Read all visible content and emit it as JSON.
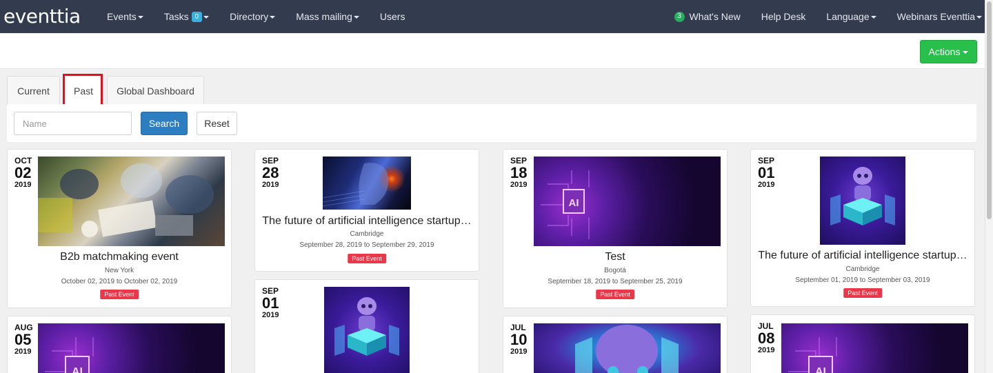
{
  "app": {
    "logo": "eventtia"
  },
  "nav": {
    "items": [
      {
        "label": "Events",
        "caret": true
      },
      {
        "label": "Tasks",
        "badge": "0",
        "caret": true
      },
      {
        "label": "Directory",
        "caret": true
      },
      {
        "label": "Mass mailing",
        "caret": true
      },
      {
        "label": "Users",
        "caret": false
      }
    ],
    "right": {
      "whats_new_count": "3",
      "whats_new": "What's New",
      "help_desk": "Help Desk",
      "language": "Language",
      "account": "Webinars Eventtia"
    }
  },
  "toolbar": {
    "actions_label": "Actions"
  },
  "tabs": [
    {
      "label": "Current",
      "active": false
    },
    {
      "label": "Past",
      "active": true
    },
    {
      "label": "Global Dashboard",
      "active": false
    }
  ],
  "search": {
    "placeholder": "Name",
    "search_label": "Search",
    "reset_label": "Reset"
  },
  "events": [
    {
      "month": "OCT",
      "day": "02",
      "year": "2019",
      "title": "B2b matchmaking event",
      "city": "New York",
      "dates": "October 02, 2019 to October 02, 2019",
      "status": "Past Event",
      "image": "meeting-photo"
    },
    {
      "month": "SEP",
      "day": "28",
      "year": "2019",
      "title": "The future of artificial intelligence startup…",
      "city": "Cambridge",
      "dates": "September 28, 2019 to September 29, 2019",
      "status": "Past Event",
      "image": "tech-face-image"
    },
    {
      "month": "SEP",
      "day": "18",
      "year": "2019",
      "title": "Test",
      "city": "Bogotá",
      "dates": "September 18, 2019 to September 25, 2019",
      "status": "Past Event",
      "image": "ai-chip-image"
    },
    {
      "month": "SEP",
      "day": "01",
      "year": "2019",
      "title": "The future of artificial intelligence startup…",
      "city": "Cambridge",
      "dates": "September 01, 2019 to September 03, 2019",
      "status": "Past Event",
      "image": "robot-image"
    },
    {
      "month": "AUG",
      "day": "05",
      "year": "2019",
      "image": "ai-chip-image"
    },
    {
      "month": "SEP",
      "day": "01",
      "year": "2019",
      "image": "robot-image"
    },
    {
      "month": "JUL",
      "day": "10",
      "year": "2019",
      "image": "robot-image"
    },
    {
      "month": "JUL",
      "day": "08",
      "year": "2019",
      "image": "ai-chip-image"
    }
  ],
  "chip_label": "AI"
}
